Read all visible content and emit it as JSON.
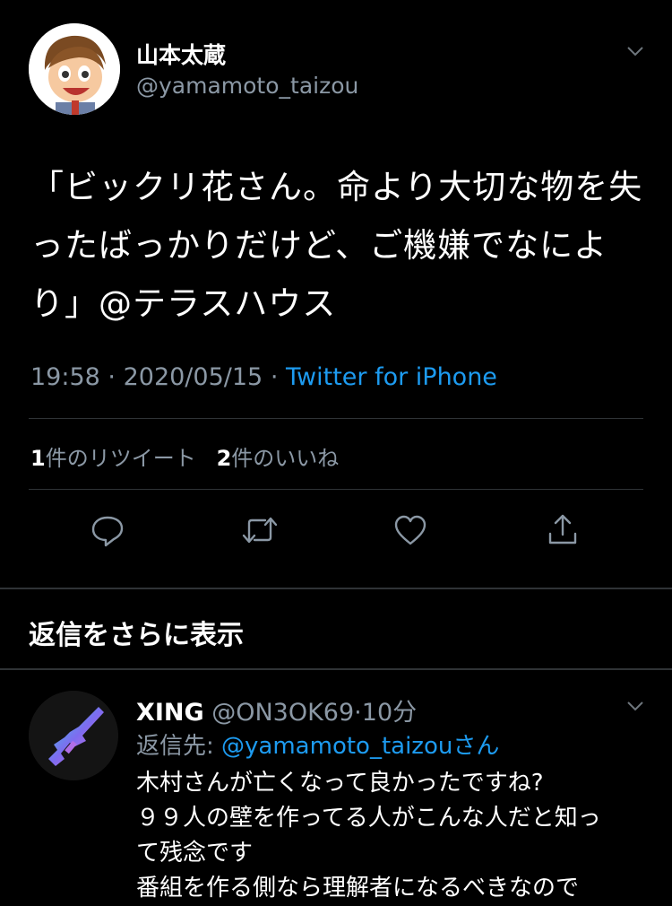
{
  "tweet": {
    "author_name": "山本太蔵",
    "author_handle": "@yamamoto_taizou",
    "text": "「ビックリ花さん。命より大切な物を失ったばっかりだけど、ご機嫌でなにより」@テラスハウス",
    "time": "19:58",
    "dot1": "·",
    "date": "2020/05/15",
    "dot2": "·",
    "source": "Twitter for iPhone",
    "retweet_count": "1",
    "retweet_label": "件のリツイート",
    "like_count": "2",
    "like_label": "件のいいね"
  },
  "icons": {
    "reply": "reply-icon",
    "retweet": "retweet-icon",
    "like": "heart-icon",
    "share": "share-icon",
    "more": "chevron-down-icon"
  },
  "show_more_replies": "返信をさらに表示",
  "reply": {
    "name": "XING",
    "handle": "@ON3OK69",
    "dot": "·",
    "time": "10分",
    "replying_label": "返信先:",
    "replying_to": "@yamamoto_taizou",
    "replying_suffix": "さん",
    "lines": [
      "木村さんが亡くなって良かったですね?",
      "９９人の壁を作ってる人がこんな人だと知っ",
      "て残念です",
      "番組を作る側なら理解者になるべきなので"
    ]
  },
  "colors": {
    "background": "#000000",
    "accent": "#1d9bf0",
    "muted": "#8b98a5",
    "divider": "#2f3336"
  }
}
